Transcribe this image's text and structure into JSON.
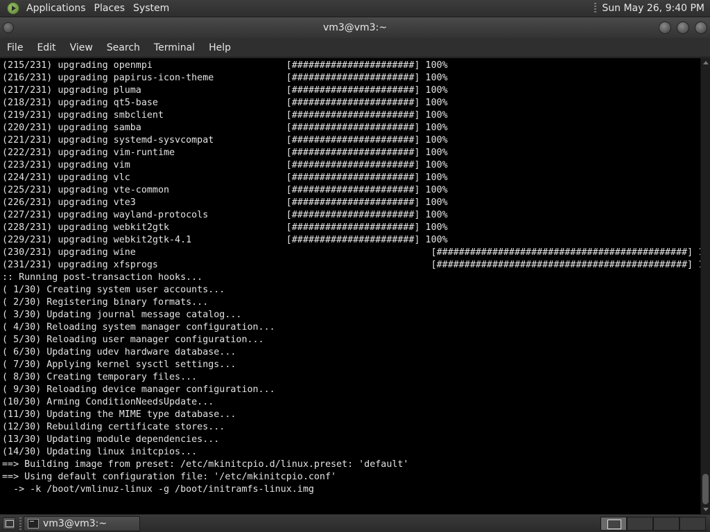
{
  "top_panel": {
    "menus": [
      "Applications",
      "Places",
      "System"
    ],
    "clock": "Sun May 26,  9:40 PM"
  },
  "window": {
    "title": "vm3@vm3:~"
  },
  "menubar": {
    "items": [
      "File",
      "Edit",
      "View",
      "Search",
      "Terminal",
      "Help"
    ]
  },
  "terminal": {
    "lines": [
      "(215/231) upgrading openmpi                        [######################] 100%",
      "(216/231) upgrading papirus-icon-theme             [######################] 100%",
      "(217/231) upgrading pluma                          [######################] 100%",
      "(218/231) upgrading qt5-base                       [######################] 100%",
      "(219/231) upgrading smbclient                      [######################] 100%",
      "(220/231) upgrading samba                          [######################] 100%",
      "(221/231) upgrading systemd-sysvcompat             [######################] 100%",
      "(222/231) upgrading vim-runtime                    [######################] 100%",
      "(223/231) upgrading vim                            [######################] 100%",
      "(224/231) upgrading vlc                            [######################] 100%",
      "(225/231) upgrading vte-common                     [######################] 100%",
      "(226/231) upgrading vte3                           [######################] 100%",
      "(227/231) upgrading wayland-protocols              [######################] 100%",
      "(228/231) upgrading webkit2gtk                     [######################] 100%",
      "(229/231) upgrading webkit2gtk-4.1                 [######################] 100%",
      "(230/231) upgrading wine                                                     [#############################################] 100%",
      "(231/231) upgrading xfsprogs                                                 [#############################################] 100%",
      ":: Running post-transaction hooks...",
      "( 1/30) Creating system user accounts...",
      "( 2/30) Registering binary formats...",
      "( 3/30) Updating journal message catalog...",
      "( 4/30) Reloading system manager configuration...",
      "( 5/30) Reloading user manager configuration...",
      "( 6/30) Updating udev hardware database...",
      "( 7/30) Applying kernel sysctl settings...",
      "( 8/30) Creating temporary files...",
      "( 9/30) Reloading device manager configuration...",
      "(10/30) Arming ConditionNeedsUpdate...",
      "(11/30) Updating the MIME type database...",
      "(12/30) Rebuilding certificate stores...",
      "(13/30) Updating module dependencies...",
      "(14/30) Updating linux initcpios...",
      "==> Building image from preset: /etc/mkinitcpio.d/linux.preset: 'default'",
      "==> Using default configuration file: '/etc/mkinitcpio.conf'",
      "  -> -k /boot/vmlinuz-linux -g /boot/initramfs-linux.img"
    ]
  },
  "taskbar": {
    "task_label": "vm3@vm3:~"
  }
}
